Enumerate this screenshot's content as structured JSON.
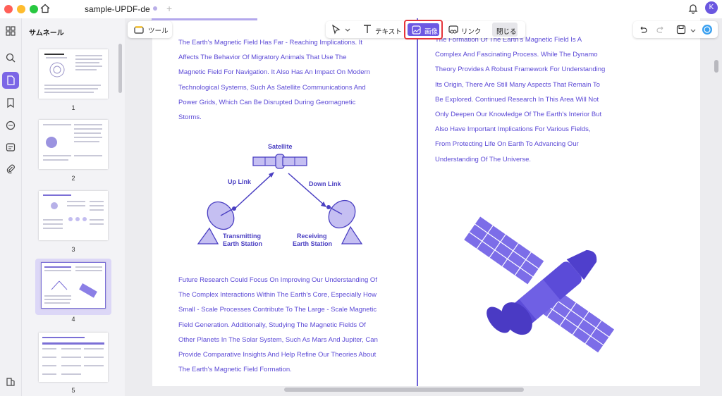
{
  "window": {
    "tab_title": "sample-UPDF-de",
    "avatar_initial": "K",
    "traffic_colors": [
      "#ff5f57",
      "#febc2e",
      "#28c840"
    ]
  },
  "sidebar": {
    "title": "サムネール",
    "pages": [
      "1",
      "2",
      "3",
      "4",
      "5"
    ],
    "selected_page": "4"
  },
  "toolbar": {
    "tools_label": "ツール",
    "text_label": "テキスト",
    "image_label": "画像",
    "link_label": "リンク",
    "close_label": "閉じる"
  },
  "document": {
    "left_top_lines": [
      "The Earth's Magnetic Field Has Far - Reaching Implications. It",
      "Affects The Behavior Of Migratory Animals That Use The",
      "Magnetic Field For Navigation. It Also Has An Impact On Modern",
      "Technological Systems, Such As Satellite Communications And",
      "Power Grids, Which Can Be Disrupted During Geomagnetic",
      "Storms."
    ],
    "left_bottom_lines": [
      "Future Research Could Focus On Improving Our Understanding Of",
      "The Complex Interactions Within The Earth's Core, Especially How",
      "Small - Scale Processes Contribute To The Large - Scale Magnetic",
      "Field Generation. Additionally, Studying The Magnetic Fields Of",
      "Other Planets In The Solar System, Such As Mars And Jupiter, Can",
      "Provide Comparative Insights And Help Refine Our Theories About",
      "The Earth's Magnetic Field Formation."
    ],
    "right_lines": [
      "The Formation Of The Earth's Magnetic Field Is A",
      "Complex And Fascinating Process. While The Dynamo",
      "Theory Provides A Robust Framework For Understanding",
      "Its Origin, There Are Still Many Aspects That Remain To",
      "Be Explored. Continued Research In This Area Will Not",
      "Only Deepen Our Knowledge Of The Earth's Interior But",
      "Also Have Important Implications For Various Fields,",
      "From Protecting Life On Earth To Advancing Our",
      "Understanding Of The Universe."
    ],
    "diagram": {
      "satellite": "Satellite",
      "up_link": "Up Link",
      "down_link": "Down Link",
      "transmitting": [
        "Transmitting",
        "Earth Station"
      ],
      "receiving": [
        "Receiving",
        "Earth Station"
      ]
    }
  },
  "colors": {
    "accent": "#6d58e3",
    "text": "#5b49d6",
    "highlight_border": "#e5343a"
  }
}
